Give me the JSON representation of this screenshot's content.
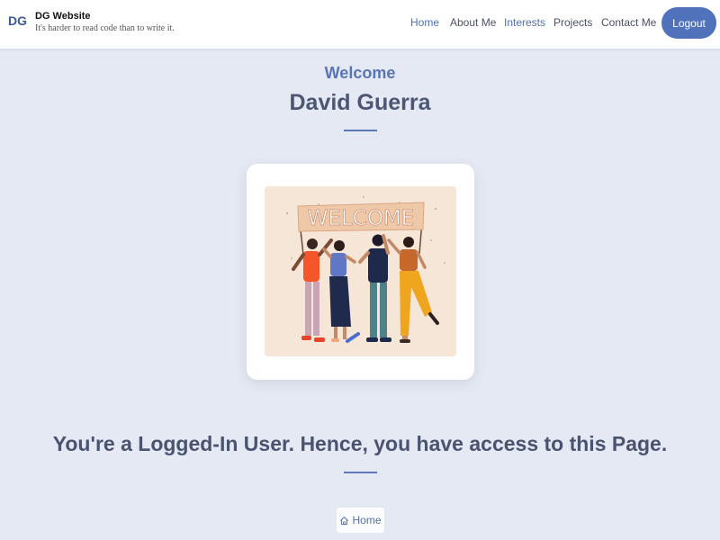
{
  "brand": {
    "logo_text": "DG",
    "title": "DG Website",
    "tagline": "It's harder to read code than to write it."
  },
  "nav": {
    "items": [
      {
        "label": "Home",
        "active": true
      },
      {
        "label": "About Me",
        "active": false
      },
      {
        "label": "Interests",
        "active": true
      },
      {
        "label": "Projects",
        "active": false
      },
      {
        "label": "Contact Me",
        "active": false
      }
    ],
    "logout_label": "Logout"
  },
  "hero": {
    "welcome_label": "Welcome",
    "user_name": "David Guerra"
  },
  "illustration": {
    "banner_text": "WELCOME"
  },
  "access_message": "You're a Logged-In User. Hence, you have access to this Page.",
  "home_button": {
    "label": "Home",
    "icon": "home-icon"
  },
  "colors": {
    "page_bg": "#e5e9f3",
    "accent": "#5072bb",
    "heading": "#4d5773",
    "illustration_bg": "#f6e6d7"
  }
}
